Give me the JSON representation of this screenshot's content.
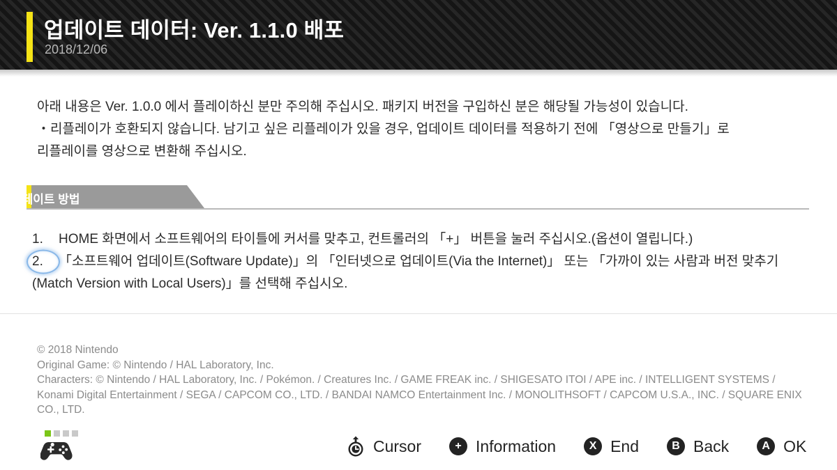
{
  "header": {
    "title": "업데이트 데이터: Ver. 1.1.0 배포",
    "date": "2018/12/06",
    "accent_color": "#f5e316"
  },
  "notice": {
    "line1": "아래 내용은 Ver. 1.0.0 에서 플레이하신 분만 주의해 주십시오. 패키지 버전을 구입하신 분은 해당될 가능성이 있습니다.",
    "line2": "・리플레이가 호환되지 않습니다. 남기고 싶은 리플레이가 있을 경우, 업데이트 데이터를 적용하기 전에 「영상으로 만들기」로",
    "line3": "리플레이를 영상으로 변환해 주십시오."
  },
  "section": {
    "label": "업데이트 방법"
  },
  "steps": [
    {
      "number": "1.",
      "highlighted": false,
      "text": "HOME 화면에서 소프트웨어의 타이틀에 커서를 맞추고, 컨트롤러의 「+」 버튼을 눌러 주십시오.(옵션이 열립니다.)"
    },
    {
      "number": "2.",
      "highlighted": true,
      "text": "「소프트웨어 업데이트(Software Update)」의 「인터넷으로 업데이트(Via the Internet)」 또는 「가까이 있는 사람과 버전 맞추기(Match Version with Local Users)」를 선택해 주십시오."
    }
  ],
  "credits": {
    "line1": "© 2018 Nintendo",
    "line2": "Original Game:  © Nintendo / HAL Laboratory, Inc.",
    "line3": "Characters:  © Nintendo / HAL Laboratory, Inc. / Pokémon. / Creatures Inc. / GAME FREAK inc. / SHIGESATO ITOI / APE inc. / INTELLIGENT SYSTEMS / Konami Digital Entertainment / SEGA / CAPCOM CO., LTD. / BANDAI NAMCO Entertainment Inc. / MONOLITHSOFT / CAPCOM U.S.A., INC. / SQUARE ENIX CO., LTD."
  },
  "footer": {
    "controller": {
      "icon": "gamepad-icon",
      "player_leds": [
        true,
        false,
        false,
        false
      ],
      "active_color": "#7bc617"
    },
    "hints": [
      {
        "icon": "left-stick-icon",
        "glyph": "",
        "label": "Cursor"
      },
      {
        "icon": "plus-button-icon",
        "glyph": "+",
        "label": "Information"
      },
      {
        "icon": "x-button-icon",
        "glyph": "X",
        "label": "End"
      },
      {
        "icon": "b-button-icon",
        "glyph": "B",
        "label": "Back"
      },
      {
        "icon": "a-button-icon",
        "glyph": "A",
        "label": "OK"
      }
    ]
  }
}
